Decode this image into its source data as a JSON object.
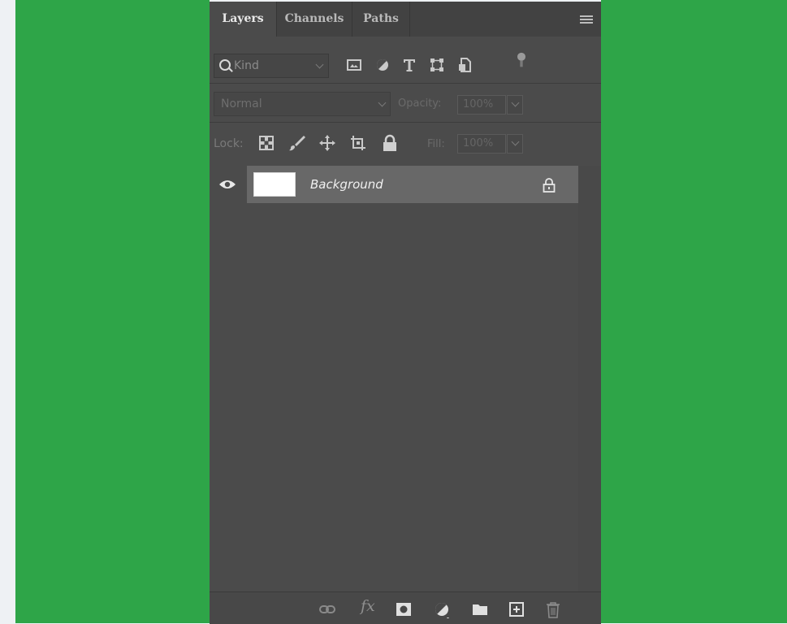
{
  "tabs": [
    {
      "label": "Layers",
      "active": true
    },
    {
      "label": "Channels",
      "active": false
    },
    {
      "label": "Paths",
      "active": false
    }
  ],
  "filter": {
    "kind_label": "Kind",
    "icons": [
      "pixel-layer-filter-icon",
      "adjustment-layer-filter-icon",
      "type-layer-filter-icon",
      "shape-layer-filter-icon",
      "smart-object-filter-icon",
      "filter-toggle-icon"
    ]
  },
  "blend": {
    "mode": "Normal",
    "opacity_label": "Opacity:",
    "opacity_value": "100%"
  },
  "lock": {
    "label": "Lock:",
    "icons": [
      "lock-transparent-pixels-icon",
      "lock-image-pixels-icon",
      "lock-position-icon",
      "lock-artboard-icon",
      "lock-all-icon"
    ],
    "fill_label": "Fill:",
    "fill_value": "100%"
  },
  "layers": [
    {
      "name": "Background",
      "visible": true,
      "locked": true,
      "thumbnail_color": "#ffffff"
    }
  ],
  "bottom_toolbar": {
    "fx_label": "fx",
    "icons": [
      "link-layers-icon",
      "layer-style-icon",
      "add-mask-icon",
      "new-adjustment-layer-icon",
      "new-group-icon",
      "new-layer-icon",
      "delete-layer-icon"
    ]
  },
  "colors": {
    "panel_bg": "#4b4b4b",
    "selected_layer_bg": "#686868",
    "backdrop_green": "#2ea548"
  }
}
